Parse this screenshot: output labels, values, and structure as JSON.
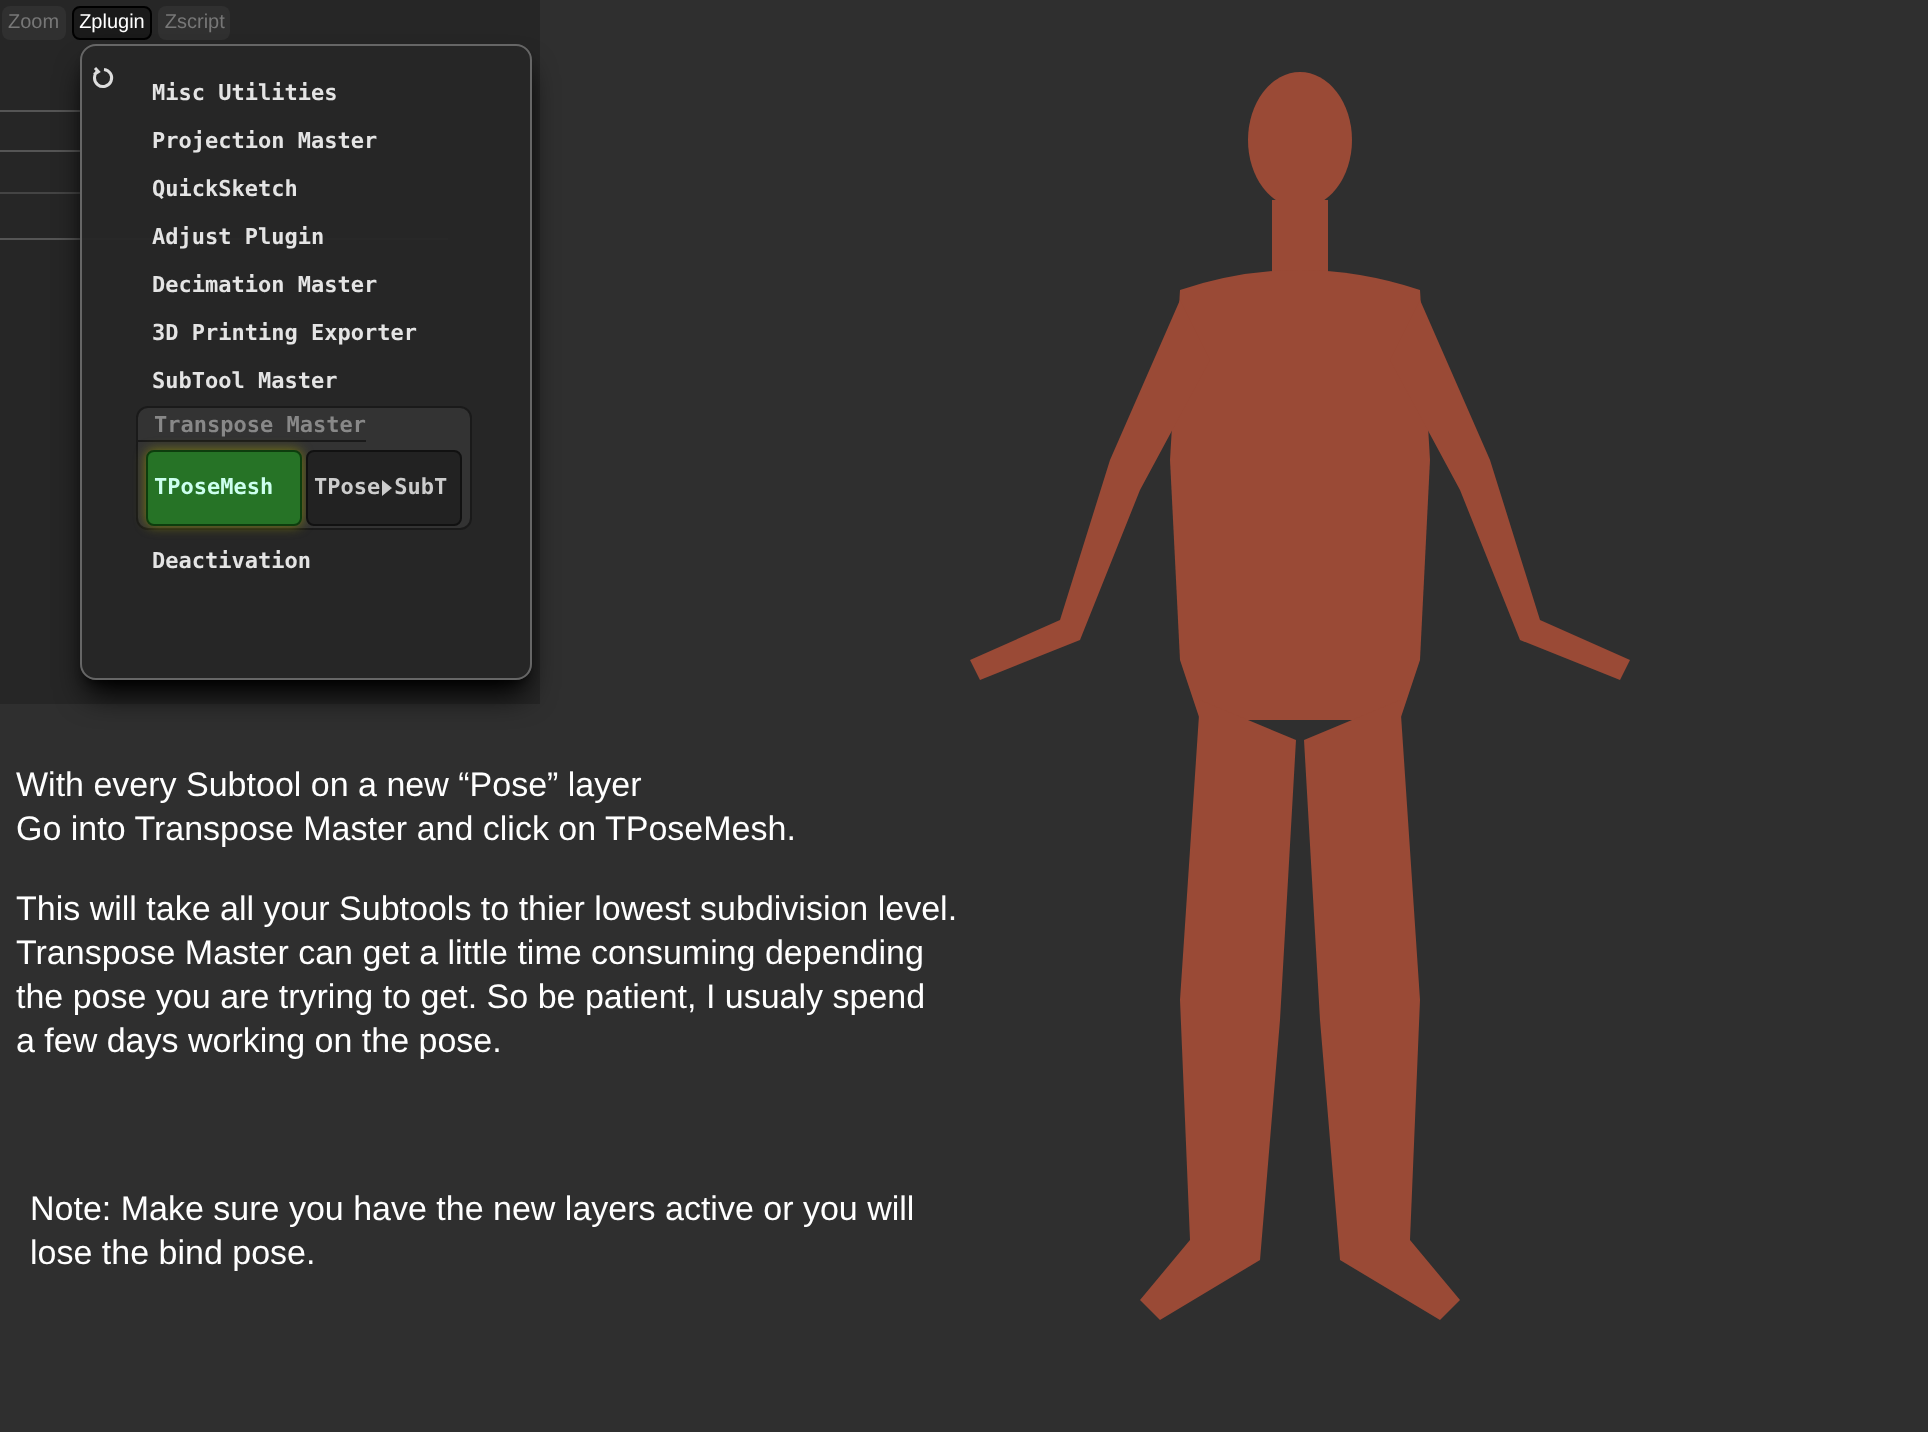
{
  "tabs": [
    {
      "label": "Zoom",
      "selected": false
    },
    {
      "label": "Zplugin",
      "selected": true
    },
    {
      "label": "Zscript",
      "selected": false
    }
  ],
  "menu": {
    "items": [
      {
        "label": "Misc Utilities"
      },
      {
        "label": "Projection Master"
      },
      {
        "label": "QuickSketch"
      },
      {
        "label": "Adjust Plugin"
      },
      {
        "label": "Decimation Master"
      },
      {
        "label": "3D Printing Exporter"
      },
      {
        "label": "SubTool Master"
      }
    ],
    "submenu": {
      "title": "Transpose Master",
      "buttons": [
        {
          "label": "TPoseMesh",
          "highlighted": true
        },
        {
          "label": "TPose",
          "label_2": "SubT",
          "highlighted": false
        }
      ]
    },
    "after_items": [
      {
        "label": "Deactivation"
      }
    ]
  },
  "instructions": [
    [
      "With every Subtool on a new “Pose” layer",
      "Go into Transpose Master and click on TPoseMesh."
    ],
    [
      "This will take all your Subtools to thier lowest subdivision level.",
      "Transpose Master can get a little time consuming depending",
      "the pose you are tryring to get. So be patient, I usualy spend",
      "a few days working on the pose."
    ]
  ],
  "note": [
    "Note:  Make sure you have the new layers active or you will",
    "lose the bind pose."
  ]
}
